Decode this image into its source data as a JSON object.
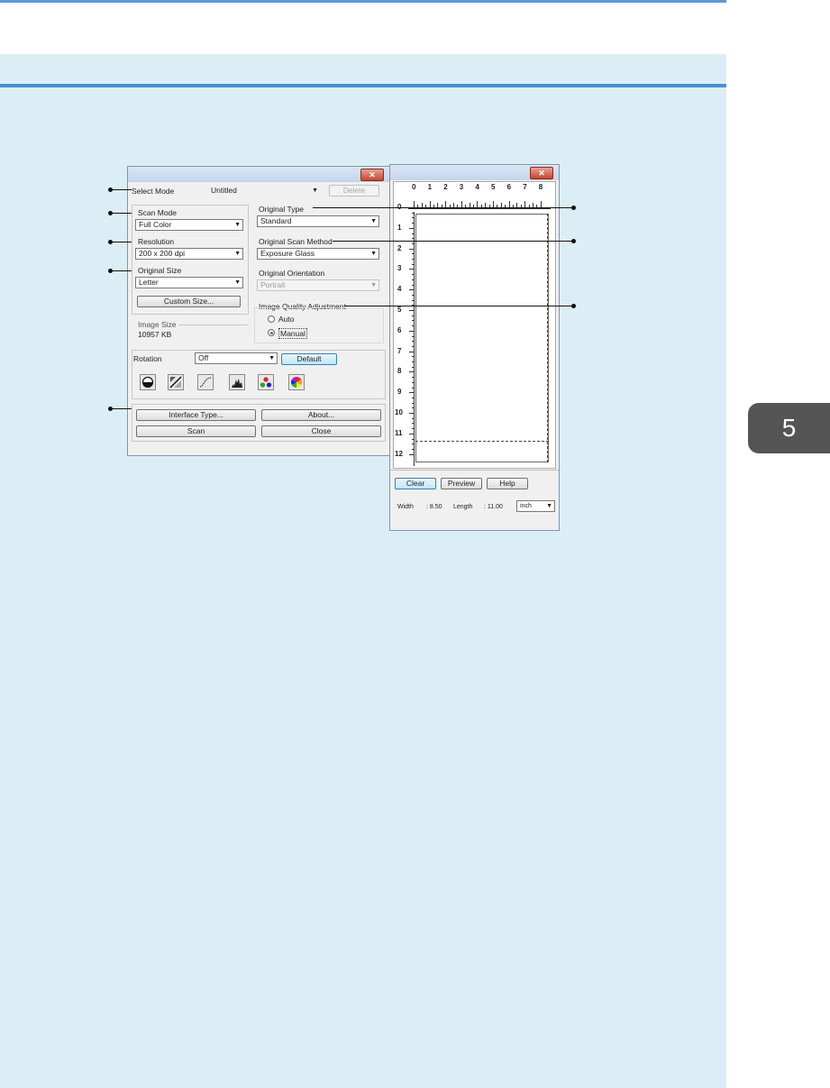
{
  "chapter_tab": "5",
  "main_dialog": {
    "close_glyph": "✕",
    "select_mode": {
      "label": "Select Mode",
      "value": "Untitled",
      "delete_label": "Delete"
    },
    "scan_mode": {
      "label": "Scan Mode",
      "value": "Full Color"
    },
    "resolution": {
      "label": "Resolution",
      "value": "200 x 200 dpi"
    },
    "original_size": {
      "label": "Original Size",
      "value": "Letter",
      "custom_size_label": "Custom Size..."
    },
    "image_size": {
      "label": "Image Size",
      "value": "10957 KB"
    },
    "original_type": {
      "label": "Original Type",
      "value": "Standard"
    },
    "original_scan_method": {
      "label": "Original Scan Method",
      "value": "Exposure Glass"
    },
    "original_orientation": {
      "label": "Original Orientation",
      "value": "Portrait"
    },
    "image_quality": {
      "label": "Image Quality Adjustment",
      "auto_label": "Auto",
      "manual_label": "Manual",
      "selected": "Manual"
    },
    "rotation": {
      "label": "Rotation",
      "value": "Off",
      "default_label": "Default"
    },
    "tool_icons": [
      "brightness-contrast-icon",
      "threshold-icon",
      "tone-curve-icon",
      "histogram-icon",
      "color-balance-icon",
      "color-wheel-icon"
    ],
    "buttons": {
      "interface_type": "Interface Type...",
      "about": "About...",
      "scan": "Scan",
      "close": "Close"
    }
  },
  "preview_dialog": {
    "close_glyph": "✕",
    "ruler_x": [
      "0",
      "1",
      "2",
      "3",
      "4",
      "5",
      "6",
      "7",
      "8"
    ],
    "ruler_y": [
      "0",
      "1",
      "2",
      "3",
      "4",
      "5",
      "6",
      "7",
      "8",
      "9",
      "10",
      "11",
      "12"
    ],
    "buttons": {
      "clear": "Clear",
      "preview": "Preview",
      "help": "Help"
    },
    "width": {
      "label": "Width",
      "value": ": 8.50"
    },
    "length": {
      "label": "Length",
      "value": ": 11.00"
    },
    "unit": "inch"
  }
}
